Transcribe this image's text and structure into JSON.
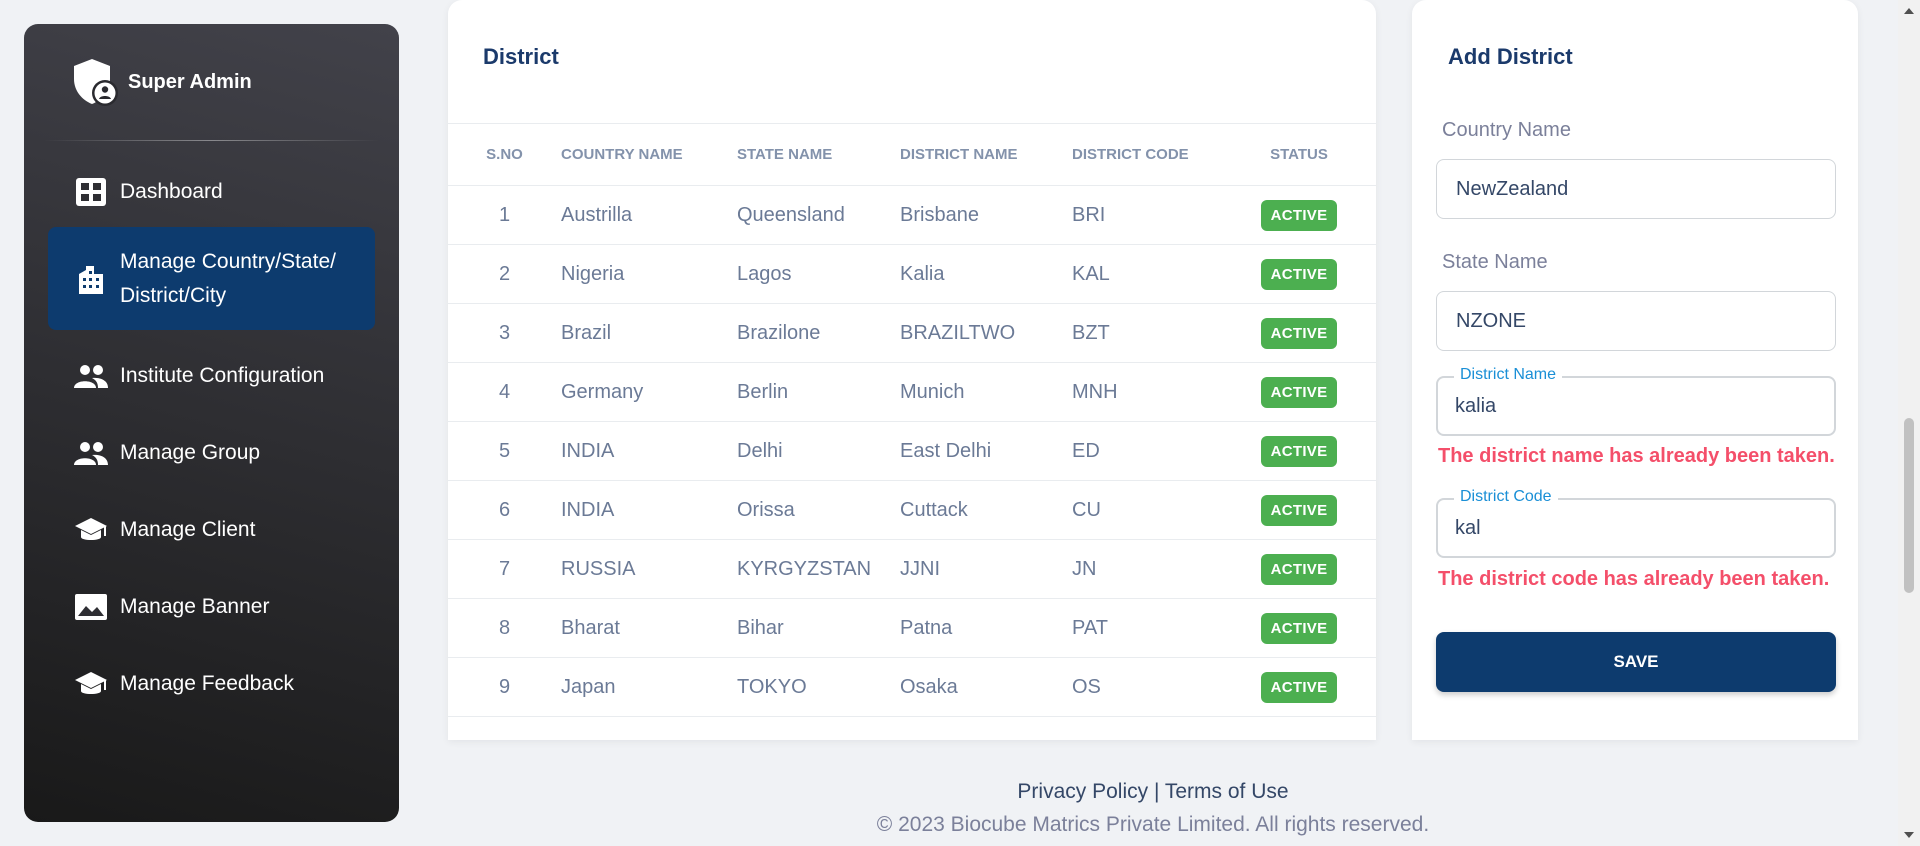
{
  "sidebar": {
    "brand": "Super Admin",
    "items": [
      {
        "label": "Dashboard",
        "icon": "dashboard-icon"
      },
      {
        "label": "Manage Country/State/\nDistrict/City",
        "icon": "building-icon"
      },
      {
        "label": "Institute Configuration",
        "icon": "people-icon"
      },
      {
        "label": "Manage Group",
        "icon": "people-icon"
      },
      {
        "label": "Manage Client",
        "icon": "school-icon"
      },
      {
        "label": "Manage Banner",
        "icon": "image-icon"
      },
      {
        "label": "Manage Feedback",
        "icon": "school-icon"
      }
    ]
  },
  "district_table": {
    "title": "District",
    "columns": [
      "S.NO",
      "COUNTRY NAME",
      "STATE NAME",
      "DISTRICT NAME",
      "DISTRICT CODE",
      "STATUS"
    ],
    "rows": [
      {
        "sno": "1",
        "country": "Austrilla",
        "state": "Queensland",
        "district": "Brisbane",
        "code": "BRI",
        "status": "ACTIVE"
      },
      {
        "sno": "2",
        "country": "Nigeria",
        "state": "Lagos",
        "district": "Kalia",
        "code": "KAL",
        "status": "ACTIVE"
      },
      {
        "sno": "3",
        "country": "Brazil",
        "state": "Brazilone",
        "district": "BRAZILTWO",
        "code": "BZT",
        "status": "ACTIVE"
      },
      {
        "sno": "4",
        "country": "Germany",
        "state": "Berlin",
        "district": "Munich",
        "code": "MNH",
        "status": "ACTIVE"
      },
      {
        "sno": "5",
        "country": "INDIA",
        "state": "Delhi",
        "district": "East Delhi",
        "code": "ED",
        "status": "ACTIVE"
      },
      {
        "sno": "6",
        "country": "INDIA",
        "state": "Orissa",
        "district": "Cuttack",
        "code": "CU",
        "status": "ACTIVE"
      },
      {
        "sno": "7",
        "country": "RUSSIA",
        "state": "KYRGYZSTAN",
        "district": "JJNI",
        "code": "JN",
        "status": "ACTIVE"
      },
      {
        "sno": "8",
        "country": "Bharat",
        "state": "Bihar",
        "district": "Patna",
        "code": "PAT",
        "status": "ACTIVE"
      },
      {
        "sno": "9",
        "country": "Japan",
        "state": "TOKYO",
        "district": "Osaka",
        "code": "OS",
        "status": "ACTIVE"
      }
    ]
  },
  "add_form": {
    "title": "Add District",
    "country_label": "Country Name",
    "country_value": "NewZealand",
    "state_label": "State Name",
    "state_value": "NZONE",
    "district_name_label": "District Name",
    "district_name_value": "kalia",
    "district_name_error": "The district name has already been taken.",
    "district_code_label": "District Code",
    "district_code_value": "kal",
    "district_code_error": "The district code has already been taken.",
    "save_label": "SAVE"
  },
  "footer": {
    "privacy": "Privacy Policy",
    "separator": " | ",
    "terms": "Terms of Use",
    "copyright": "© 2023 Biocube Matrics Private Limited. All rights reserved."
  },
  "colors": {
    "accent": "#0d3b6e",
    "badge": "#4caf50",
    "error": "#f44f6a",
    "focus": "#1a8fd6"
  }
}
